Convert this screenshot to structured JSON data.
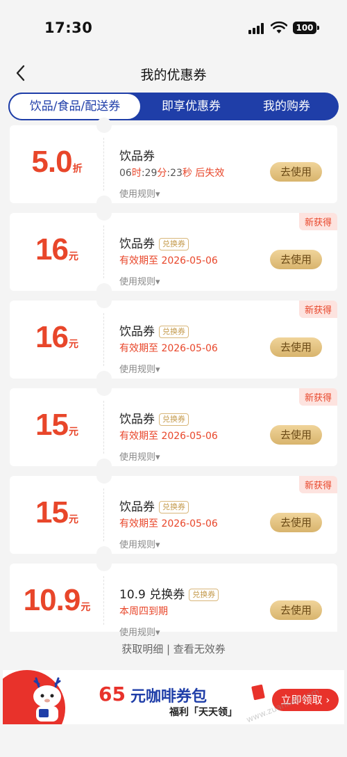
{
  "status": {
    "time": "17:30",
    "battery": "100"
  },
  "header": {
    "title": "我的优惠券"
  },
  "tabs": [
    {
      "label": "饮品/食品/配送券",
      "active": true
    },
    {
      "label": "即享优惠券",
      "active": false
    },
    {
      "label": "我的购券",
      "active": false
    }
  ],
  "coupons": [
    {
      "amount": "5.0",
      "unit": "折",
      "name": "饮品券",
      "tag": "",
      "validity_prefix": "06",
      "h": "时",
      "m_val": ":29",
      "m": "分",
      "s_val": ":23",
      "s": "秒",
      "validity_suffix": " 后失效",
      "rules": "使用规则▾",
      "button": "去使用",
      "badge": ""
    },
    {
      "amount": "16",
      "unit": "元",
      "name": "饮品券",
      "tag": "兑换券",
      "validity": "有效期至 2026-05-06",
      "rules": "使用规则▾",
      "button": "去使用",
      "badge": "新获得"
    },
    {
      "amount": "16",
      "unit": "元",
      "name": "饮品券",
      "tag": "兑换券",
      "validity": "有效期至 2026-05-06",
      "rules": "使用规则▾",
      "button": "去使用",
      "badge": "新获得"
    },
    {
      "amount": "15",
      "unit": "元",
      "name": "饮品券",
      "tag": "兑换券",
      "validity": "有效期至 2026-05-06",
      "rules": "使用规则▾",
      "button": "去使用",
      "badge": "新获得"
    },
    {
      "amount": "15",
      "unit": "元",
      "name": "饮品券",
      "tag": "兑换券",
      "validity": "有效期至 2026-05-06",
      "rules": "使用规则▾",
      "button": "去使用",
      "badge": "新获得"
    },
    {
      "amount": "10.9",
      "unit": "元",
      "name": "10.9 兑换券",
      "tag": "兑换券",
      "validity": "本周四到期",
      "rules": "使用规则▾",
      "button": "去使用",
      "badge": ""
    }
  ],
  "footer": {
    "details": "获取明细",
    "separator": " | ",
    "invalid": "查看无效券"
  },
  "banner": {
    "number": "65",
    "title": "元咖啡券包",
    "subtitle": "福利「天天领」",
    "button": "立即领取 ›"
  },
  "watermark": "www.zuanke8.com",
  "colors": {
    "accent_red": "#e8462a",
    "tab_blue": "#1f3ea8",
    "button_gold": "#d8b46d"
  }
}
